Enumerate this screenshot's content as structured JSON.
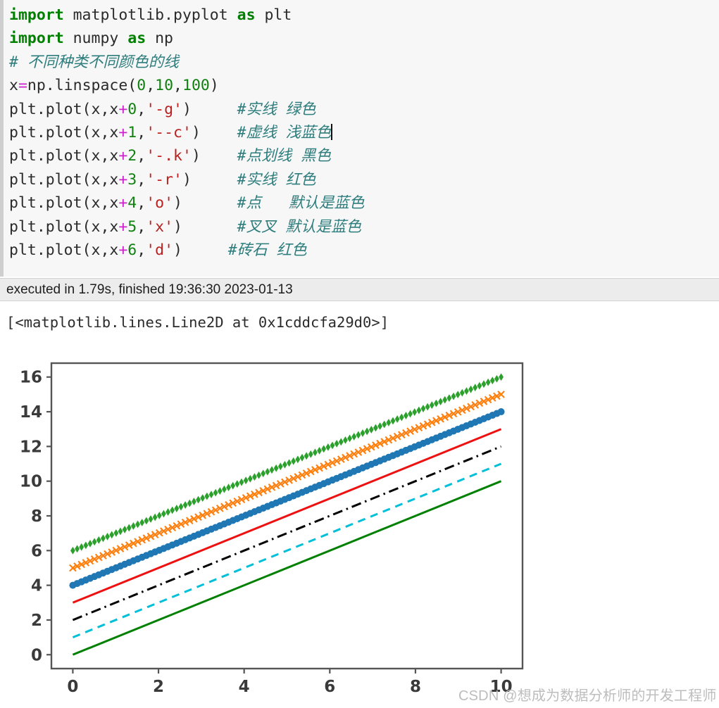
{
  "code_cell": {
    "background": "#f7f7f7",
    "lines": [
      {
        "id": "line-1",
        "tokens": [
          {
            "t": "kw",
            "s": "import"
          },
          {
            "t": "nm",
            "s": " matplotlib.pyplot "
          },
          {
            "t": "kw",
            "s": "as"
          },
          {
            "t": "nm",
            "s": " plt"
          }
        ]
      },
      {
        "id": "line-2",
        "tokens": [
          {
            "t": "kw",
            "s": "import"
          },
          {
            "t": "nm",
            "s": " numpy "
          },
          {
            "t": "kw",
            "s": "as"
          },
          {
            "t": "nm",
            "s": " np"
          }
        ]
      },
      {
        "id": "line-3",
        "tokens": [
          {
            "t": "cmt",
            "s": "# 不同种类不同颜色的线"
          }
        ]
      },
      {
        "id": "line-4",
        "tokens": [
          {
            "t": "nm",
            "s": "x"
          },
          {
            "t": "op",
            "s": "="
          },
          {
            "t": "nm",
            "s": "np.linspace("
          },
          {
            "t": "num",
            "s": "0"
          },
          {
            "t": "nm",
            "s": ","
          },
          {
            "t": "num",
            "s": "10"
          },
          {
            "t": "nm",
            "s": ","
          },
          {
            "t": "num",
            "s": "100"
          },
          {
            "t": "nm",
            "s": ")"
          }
        ]
      },
      {
        "id": "line-5",
        "tokens": [
          {
            "t": "nm",
            "s": "plt.plot(x,x"
          },
          {
            "t": "op",
            "s": "+"
          },
          {
            "t": "num",
            "s": "0"
          },
          {
            "t": "nm",
            "s": ","
          },
          {
            "t": "str",
            "s": "'-g'"
          },
          {
            "t": "nm",
            "s": ")     "
          },
          {
            "t": "cmt",
            "s": "#实线 绿色"
          }
        ]
      },
      {
        "id": "line-6",
        "tokens": [
          {
            "t": "nm",
            "s": "plt.plot(x,x"
          },
          {
            "t": "op",
            "s": "+"
          },
          {
            "t": "num",
            "s": "1"
          },
          {
            "t": "nm",
            "s": ","
          },
          {
            "t": "str",
            "s": "'--c'"
          },
          {
            "t": "nm",
            "s": ")    "
          },
          {
            "t": "cmt",
            "s": "#虚线 浅蓝色"
          },
          {
            "t": "caret",
            "s": ""
          }
        ]
      },
      {
        "id": "line-7",
        "tokens": [
          {
            "t": "nm",
            "s": "plt.plot(x,x"
          },
          {
            "t": "op",
            "s": "+"
          },
          {
            "t": "num",
            "s": "2"
          },
          {
            "t": "nm",
            "s": ","
          },
          {
            "t": "str",
            "s": "'-.k'"
          },
          {
            "t": "nm",
            "s": ")    "
          },
          {
            "t": "cmt",
            "s": "#点划线 黑色"
          }
        ]
      },
      {
        "id": "line-8",
        "tokens": [
          {
            "t": "nm",
            "s": "plt.plot(x,x"
          },
          {
            "t": "op",
            "s": "+"
          },
          {
            "t": "num",
            "s": "3"
          },
          {
            "t": "nm",
            "s": ","
          },
          {
            "t": "str",
            "s": "'-r'"
          },
          {
            "t": "nm",
            "s": ")     "
          },
          {
            "t": "cmt",
            "s": "#实线 红色"
          }
        ]
      },
      {
        "id": "line-9",
        "tokens": [
          {
            "t": "nm",
            "s": "plt.plot(x,x"
          },
          {
            "t": "op",
            "s": "+"
          },
          {
            "t": "num",
            "s": "4"
          },
          {
            "t": "nm",
            "s": ","
          },
          {
            "t": "str",
            "s": "'o'"
          },
          {
            "t": "nm",
            "s": ")      "
          },
          {
            "t": "cmt",
            "s": "#点   默认是蓝色"
          }
        ]
      },
      {
        "id": "line-10",
        "tokens": [
          {
            "t": "nm",
            "s": "plt.plot(x,x"
          },
          {
            "t": "op",
            "s": "+"
          },
          {
            "t": "num",
            "s": "5"
          },
          {
            "t": "nm",
            "s": ","
          },
          {
            "t": "str",
            "s": "'x'"
          },
          {
            "t": "nm",
            "s": ")      "
          },
          {
            "t": "cmt",
            "s": "#叉叉 默认是蓝色"
          }
        ]
      },
      {
        "id": "line-11",
        "tokens": [
          {
            "t": "nm",
            "s": "plt.plot(x,x"
          },
          {
            "t": "op",
            "s": "+"
          },
          {
            "t": "num",
            "s": "6"
          },
          {
            "t": "nm",
            "s": ","
          },
          {
            "t": "str",
            "s": "'d'"
          },
          {
            "t": "nm",
            "s": ")     "
          },
          {
            "t": "cmt",
            "s": "#砖石 红色"
          }
        ]
      }
    ]
  },
  "exec_status": {
    "text": "executed in 1.79s, finished 19:36:30 2023-01-13",
    "duration": "1.79s",
    "finished_time": "19:36:30",
    "finished_date": "2023-01-13"
  },
  "output": {
    "repr_text": "[<matplotlib.lines.Line2D at 0x1cddcfa29d0>]"
  },
  "watermark": {
    "text": "CSDN @想成为数据分析师的开发工程师",
    "color": "#bdbdbd"
  },
  "chart_data": {
    "type": "line",
    "title": "",
    "xlabel": "",
    "ylabel": "",
    "xlim": [
      -0.5,
      10.5
    ],
    "ylim": [
      -0.8,
      16.8
    ],
    "xticks": [
      0,
      2,
      4,
      6,
      8,
      10
    ],
    "yticks": [
      0,
      2,
      4,
      6,
      8,
      10,
      12,
      14,
      16
    ],
    "grid": false,
    "legend": "none",
    "x": [
      0,
      10
    ],
    "series": [
      {
        "name": "x+0",
        "fmt": "-g",
        "style": "solid",
        "marker": "none",
        "color": "#008000",
        "values": [
          0,
          10
        ],
        "comment": "实线 绿色"
      },
      {
        "name": "x+1",
        "fmt": "--c",
        "style": "dashed",
        "marker": "none",
        "color": "#00bfd8",
        "values": [
          1,
          11
        ],
        "comment": "虚线 浅蓝色"
      },
      {
        "name": "x+2",
        "fmt": "-.k",
        "style": "dashdot",
        "marker": "none",
        "color": "#000000",
        "values": [
          2,
          12
        ],
        "comment": "点划线 黑色"
      },
      {
        "name": "x+3",
        "fmt": "-r",
        "style": "solid",
        "marker": "none",
        "color": "#ee1111",
        "values": [
          3,
          13
        ],
        "comment": "实线 红色"
      },
      {
        "name": "x+4",
        "fmt": "o",
        "style": "none",
        "marker": "circle",
        "color": "#1f77b4",
        "values": [
          4,
          14
        ],
        "comment": "点 默认是蓝色"
      },
      {
        "name": "x+5",
        "fmt": "x",
        "style": "none",
        "marker": "x",
        "color": "#ff7f0e",
        "values": [
          5,
          15
        ],
        "comment": "叉叉 默认是蓝色"
      },
      {
        "name": "x+6",
        "fmt": "d",
        "style": "none",
        "marker": "diamond",
        "color": "#2ca02c",
        "values": [
          6,
          16
        ],
        "comment": "砖石 红色"
      }
    ],
    "n_points": 100
  }
}
